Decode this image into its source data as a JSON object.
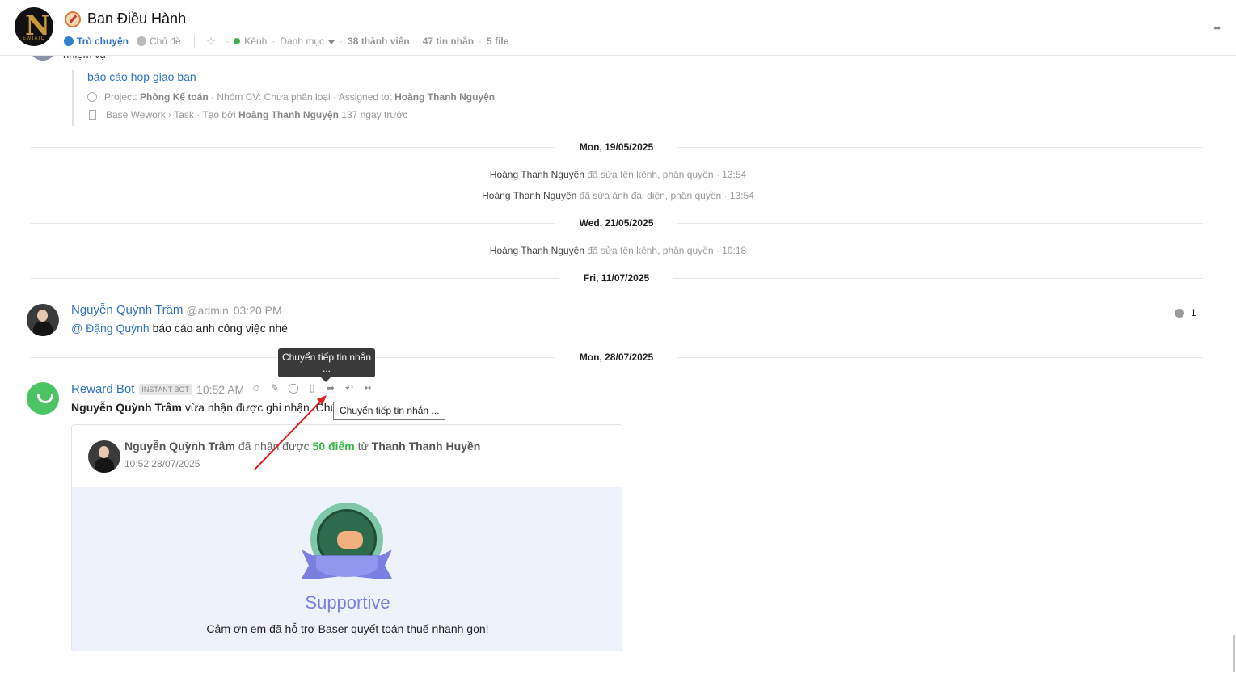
{
  "header": {
    "logo_text": "N",
    "logo_subtext": "EWTATO",
    "title": "Ban Điều Hành",
    "tab_chat": "Trò chuyện",
    "tab_topic": "Chủ đề",
    "channel": "Kênh",
    "category": "Danh mục",
    "members": "38 thành viên",
    "messages": "47 tin nhắn",
    "files": "5 file",
    "more": "••"
  },
  "prev_message": {
    "partial_text": "nhiệm vụ",
    "task_title": "báo cáo họp giao ban",
    "project_label": "Project:",
    "project_name": "Phòng Kế toán",
    "group_text": "· Nhóm CV: Chưa phân loại · Assigned to:",
    "assignee": "Hoàng Thanh Nguyện",
    "source_text": "Base Wework › Task · Tạo bởi",
    "creator": "Hoàng Thanh Nguyện",
    "age": "137 ngày trước"
  },
  "timeline": {
    "date1": "Mon, 19/05/2025",
    "sys1_user": "Hoàng Thanh Nguyện",
    "sys1_text": "đã sửa tên kênh, phân quyền · 13:54",
    "sys2_user": "Hoàng Thanh Nguyện",
    "sys2_text": "đã sửa ảnh đại diện, phân quyền · 13:54",
    "date2": "Wed, 21/05/2025",
    "sys3_user": "Hoàng Thanh Nguyện",
    "sys3_text": "đã sửa tên kênh, phân quyền · 10:18",
    "date3": "Fri, 11/07/2025",
    "date4": "Mon, 28/07/2025"
  },
  "msg1": {
    "name": "Nguyễn Quỳnh Trâm",
    "handle": "@admin",
    "time": "03:20 PM",
    "mention_prefix": "@",
    "mention": "Đặng Quỳnh",
    "text": "báo cáo anh công việc nhé",
    "reply_count": "1"
  },
  "msg2": {
    "name": "Reward Bot",
    "badge": "INSTANT BOT",
    "time": "10:52 AM",
    "body_name": "Nguyễn Quỳnh Trâm",
    "body_text": "vừa nhận được ghi nhận. Chúc",
    "tooltip_dark": "Chuyển tiếp tin nhắn ...",
    "tooltip_light": "Chuyển tiếp tin nhắn ..."
  },
  "card": {
    "receiver": "Nguyễn Quỳnh Trâm",
    "received_text": "đã nhận được",
    "points": "50 điểm",
    "from_text": "từ",
    "giver": "Thanh Thanh Huyền",
    "time": "10:52 28/07/2025",
    "badge_name": "Supportive",
    "message": "Cảm ơn em đã hỗ trợ Baser quyết toán thuế nhanh gọn!"
  },
  "colors": {
    "link": "#2f72c4",
    "online": "#3bb54a",
    "badge_purple": "#7a7fe0",
    "annotation_arrow": "#e02020"
  }
}
